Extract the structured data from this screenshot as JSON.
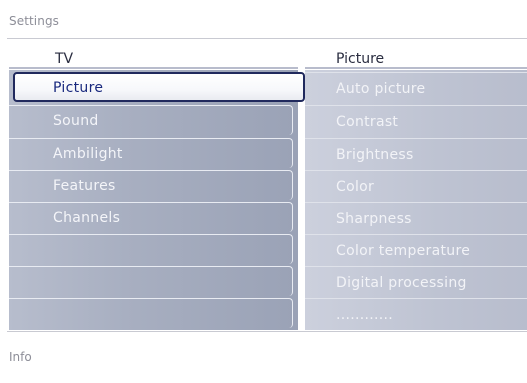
{
  "top_bar": {
    "title": "Settings"
  },
  "left_column": {
    "header": "TV",
    "items": [
      {
        "label": "Picture",
        "selected": true
      },
      {
        "label": "Sound"
      },
      {
        "label": "Ambilight"
      },
      {
        "label": "Features"
      },
      {
        "label": "Channels"
      },
      {
        "label": ""
      },
      {
        "label": ""
      },
      {
        "label": ""
      }
    ]
  },
  "right_column": {
    "header": "Picture",
    "items": [
      {
        "label": "Auto picture"
      },
      {
        "label": "Contrast"
      },
      {
        "label": "Brightness"
      },
      {
        "label": "Color"
      },
      {
        "label": "Sharpness"
      },
      {
        "label": "Color temperature"
      },
      {
        "label": "Digital processing"
      },
      {
        "label": "............"
      }
    ]
  },
  "info_panel": {
    "label": "Info"
  },
  "colors": {
    "selection_border": "#20295d",
    "selection_text": "#19297e",
    "menu_text": "#f4f5f9",
    "header_text": "#2a2d40",
    "muted_text": "#8d8e98"
  }
}
